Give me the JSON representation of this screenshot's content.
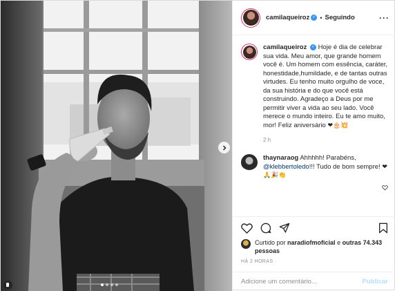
{
  "post": {
    "author": "camilaqueiroz",
    "follow_status": "Seguindo",
    "separator": "•",
    "more_icon": "more-horizontal-icon"
  },
  "caption": {
    "author": "camilaqueiroz",
    "text": "Hoje é dia de celebrar sua vida. Meu amor, que grande homem você é. Um homem com essência, caráter, honestidade,humildade, e de tantas outras virtudes. Eu tenho muito orgulho de voce, da sua história e do que você está construindo. Agradeço a Deus por me permitir viver a vida ao seu lado. Você merece o mundo inteiro. Eu te amo muito, mor! Feliz aniversário",
    "emojis": "❤🎂💥",
    "time": "2 h"
  },
  "comment": {
    "author": "thaynaraog",
    "text_before": "Ahhhhh! Parabéns,",
    "mention": "@klebbertoledo",
    "text_after": "!!! Tudo de bom sempre!",
    "emojis": "❤🙏🎉👏"
  },
  "likes": {
    "prefix": "Curtido por",
    "user": "naradiofmoficial",
    "middle": "e",
    "others": "outras 74.343 pessoas"
  },
  "timestamp": "HÁ 2 HORAS",
  "add_comment": {
    "placeholder": "Adicione um comentário...",
    "publish_label": "Publicar"
  },
  "colors": {
    "verified": "#3897f0",
    "story_ring": "#e1306c",
    "publish_disabled": "#b2dffc",
    "muted": "#8e8e8e"
  },
  "carousel": {
    "slides": 4,
    "active": 1
  }
}
